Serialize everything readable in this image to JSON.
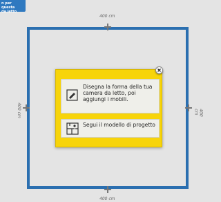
{
  "corner_tag": {
    "line1": "n per questa",
    "line2": "da letto"
  },
  "room": {
    "width_label": "400 cm",
    "height_label": "400 cm"
  },
  "dialog": {
    "options": [
      {
        "label": "Disegna la forma della tua camera da letto, poi aggiungi i mobili.",
        "icon": "draw-shape-icon"
      },
      {
        "label": "Segui il modello di progetto",
        "icon": "floorplan-template-icon"
      }
    ],
    "close_icon": "close-icon"
  },
  "colors": {
    "wall": "#2b6fb0",
    "dialog_bg": "#f7d40a",
    "tag_bg": "#2f79c0"
  }
}
